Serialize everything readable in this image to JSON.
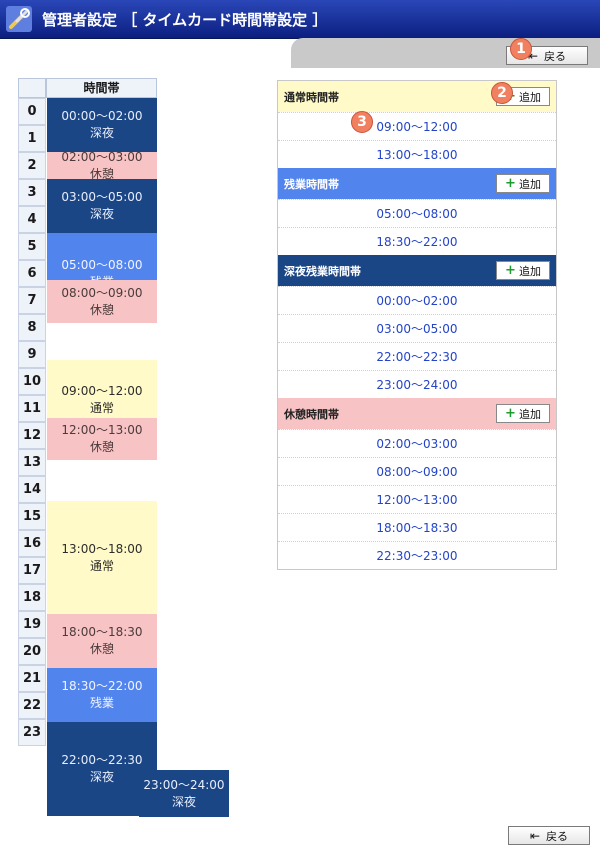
{
  "header": {
    "title": "管理者設定 ［ タイムカード時間帯設定 ］",
    "icon": "tools-icon"
  },
  "back_label": "戻る",
  "badges": [
    "1",
    "2",
    "3"
  ],
  "schedule": {
    "column_header": "時間帯",
    "hours": [
      "0",
      "1",
      "2",
      "3",
      "4",
      "5",
      "6",
      "7",
      "8",
      "9",
      "10",
      "11",
      "12",
      "13",
      "14",
      "15",
      "16",
      "17",
      "18",
      "19",
      "20",
      "21",
      "22",
      "23"
    ],
    "blocks": [
      {
        "time": "00:00〜02:00",
        "type": "深夜"
      },
      {
        "time": "02:00〜03:00",
        "type": "休憩"
      },
      {
        "time": "03:00〜05:00",
        "type": "深夜"
      },
      {
        "time": "05:00〜08:00",
        "type": "残業"
      },
      {
        "time": "08:00〜09:00",
        "type": "休憩"
      },
      {
        "time": "09:00〜12:00",
        "type": "通常"
      },
      {
        "time": "12:00〜13:00",
        "type": "休憩"
      },
      {
        "time": "13:00〜18:00",
        "type": "通常"
      },
      {
        "time": "18:00〜18:30",
        "type": "休憩"
      },
      {
        "time": "18:30〜22:00",
        "type": "残業"
      },
      {
        "time": "22:00〜22:30",
        "type": "深夜"
      },
      {
        "time": "23:00〜24:00",
        "type": "深夜"
      }
    ]
  },
  "sections": [
    {
      "title": "通常時間帯",
      "add": "追加",
      "color": "#fffac8",
      "text": "#222222",
      "rows": [
        "09:00〜12:00",
        "13:00〜18:00"
      ]
    },
    {
      "title": "残業時間帯",
      "add": "追加",
      "color": "#5284ee",
      "text": "#ffffff",
      "rows": [
        "05:00〜08:00",
        "18:30〜22:00"
      ]
    },
    {
      "title": "深夜残業時間帯",
      "add": "追加",
      "color": "#1b4686",
      "text": "#ffffff",
      "rows": [
        "00:00〜02:00",
        "03:00〜05:00",
        "22:00〜22:30",
        "23:00〜24:00"
      ]
    },
    {
      "title": "休憩時間帯",
      "add": "追加",
      "color": "#f8c3c4",
      "text": "#222222",
      "rows": [
        "02:00〜03:00",
        "08:00〜09:00",
        "12:00〜13:00",
        "18:00〜18:30",
        "22:30〜23:00"
      ]
    }
  ]
}
